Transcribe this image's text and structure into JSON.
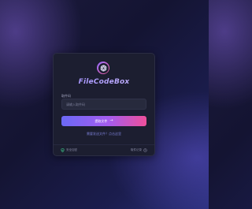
{
  "brand": {
    "title": "FileCodeBox",
    "logo_icon": "aperture-icon",
    "accent_start": "#6b69f5",
    "accent_end": "#ef4f9a"
  },
  "form": {
    "code_label": "取件码",
    "code_placeholder": "请输入取件码",
    "code_value": "",
    "submit_label": "提取文件",
    "submit_icon": "arrow-right-icon"
  },
  "link": {
    "send_text": "需要发送文件？点击这里"
  },
  "footer": {
    "security_text": "安全加密",
    "security_icon": "shield-check-icon",
    "records_text": "取件记录",
    "records_icon": "clock-icon"
  }
}
